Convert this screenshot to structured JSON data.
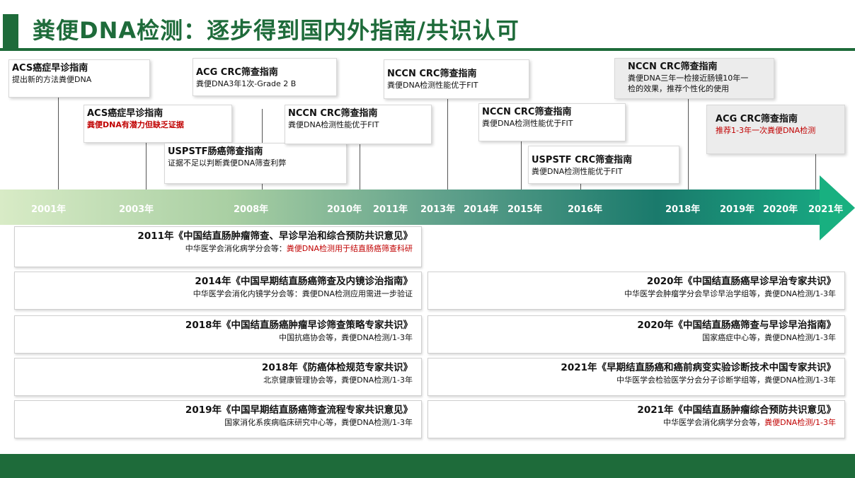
{
  "title": "粪便DNA检测：逐步得到国内外指南/共识认可",
  "timeline": {
    "years": [
      "2001年",
      "2003年",
      "2008年",
      "2010年",
      "2011年",
      "2013年",
      "2014年",
      "2015年",
      "2016年",
      "2018年",
      "2019年",
      "2020年",
      "2021年"
    ]
  },
  "events": [
    {
      "head": "ACS癌症早诊指南",
      "desc": "提出新的方法粪便DNA"
    },
    {
      "head": "ACS癌症早诊指南",
      "desc": "粪便DNA有潜力但缺乏证据"
    },
    {
      "head": "ACG CRC筛查指南",
      "desc": "粪便DNA3年1次-Grade 2 B"
    },
    {
      "head": "USPSTF肠癌筛查指南",
      "desc": "证据不足以判断粪便DNA筛查利弊"
    },
    {
      "head": "NCCN CRC筛查指南",
      "desc": "粪便DNA检测性能优于FIT"
    },
    {
      "head": "NCCN CRC筛查指南",
      "desc": "粪便DNA检测性能优于FIT"
    },
    {
      "head": "NCCN CRC筛查指南",
      "desc": "粪便DNA检测性能优于FIT"
    },
    {
      "head": "USPSTF CRC筛查指南",
      "desc": "粪便DNA检测性能优于FIT"
    },
    {
      "head": "NCCN CRC筛查指南",
      "desc1": "粪便DNA三年一检接近肠镜10年一",
      "desc2": "检的效果，推荐个性化的使用"
    },
    {
      "head": "ACG CRC筛查指南",
      "desc": "推荐1-3年一次粪便DNA检测"
    }
  ],
  "guidelines_left": [
    {
      "title": "2011年《中国结直肠肿瘤筛查、早诊早治和综合预防共识意见》",
      "org": "中华医学会消化病学分会等：",
      "highlight": "粪便DNA检测用于结直肠癌筛查科研"
    },
    {
      "title": "2014年《中国早期结直肠癌筛查及内镜诊治指南》",
      "org": "中华医学会消化内镜学分会等：粪便DNA检测应用需进一步验证"
    },
    {
      "title": "2018年《中国结直肠癌肿瘤早诊筛查策略专家共识》",
      "org": "中国抗癌协会等，粪便DNA检测/1-3年"
    },
    {
      "title": "2018年《防癌体检规范专家共识》",
      "org": "北京健康管理协会等，粪便DNA检测/1-3年"
    },
    {
      "title": "2019年《中国早期结直肠癌筛查流程专家共识意见》",
      "org": "国家消化系疾病临床研究中心等，粪便DNA检测/1-3年"
    }
  ],
  "guidelines_right": [
    {
      "title": "2020年《中国结直肠癌早诊早治专家共识》",
      "org": "中华医学会肿瘤学分会早诊早治学组等，粪便DNA检测/1-3年"
    },
    {
      "title": "2020年《中国结直肠癌筛查与早诊早治指南》",
      "org": "国家癌症中心等，粪便DNA检测/1-3年"
    },
    {
      "title": "2021年《早期结直肠癌和癌前病变实验诊断技术中国专家共识》",
      "org": "中华医学会检验医学分会分子诊断学组等，粪便DNA检测/1-3年"
    },
    {
      "title": "2021年《中国结直肠肿瘤综合预防共识意见》",
      "org": "中华医学会消化病学分会等，",
      "highlight": "粪便DNA检测/1-3年"
    }
  ],
  "colors": {
    "brand": "#1e6b3a",
    "highlight": "#c00000"
  }
}
